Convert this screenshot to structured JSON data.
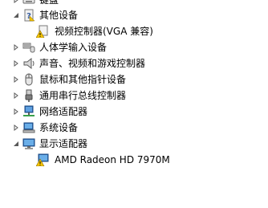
{
  "tree": {
    "items": [
      {
        "label": "键盘",
        "icon": "keyboard-icon",
        "level": 1,
        "state": "collapsed"
      },
      {
        "label": "其他设备",
        "icon": "unknown-device-icon",
        "level": 1,
        "state": "expanded"
      },
      {
        "label": "视频控制器(VGA 兼容)",
        "icon": "warning-device-icon",
        "level": 2
      },
      {
        "label": "人体学输入设备",
        "icon": "hid-icon",
        "level": 1,
        "state": "collapsed"
      },
      {
        "label": "声音、视频和游戏控制器",
        "icon": "speaker-icon",
        "level": 1,
        "state": "collapsed"
      },
      {
        "label": "鼠标和其他指针设备",
        "icon": "mouse-icon",
        "level": 1,
        "state": "collapsed"
      },
      {
        "label": "通用串行总线控制器",
        "icon": "usb-icon",
        "level": 1,
        "state": "collapsed"
      },
      {
        "label": "网络适配器",
        "icon": "network-icon",
        "level": 1,
        "state": "collapsed"
      },
      {
        "label": "系统设备",
        "icon": "system-device-icon",
        "level": 1,
        "state": "collapsed"
      },
      {
        "label": "显示适配器",
        "icon": "display-adapter-icon",
        "level": 1,
        "state": "expanded"
      },
      {
        "label": "AMD Radeon HD 7970M",
        "icon": "warning-display-icon",
        "level": 2
      }
    ]
  },
  "colors": {
    "warning": "#f5c400",
    "expander": "#595959",
    "monitor_screen": "#2f6fb7"
  }
}
